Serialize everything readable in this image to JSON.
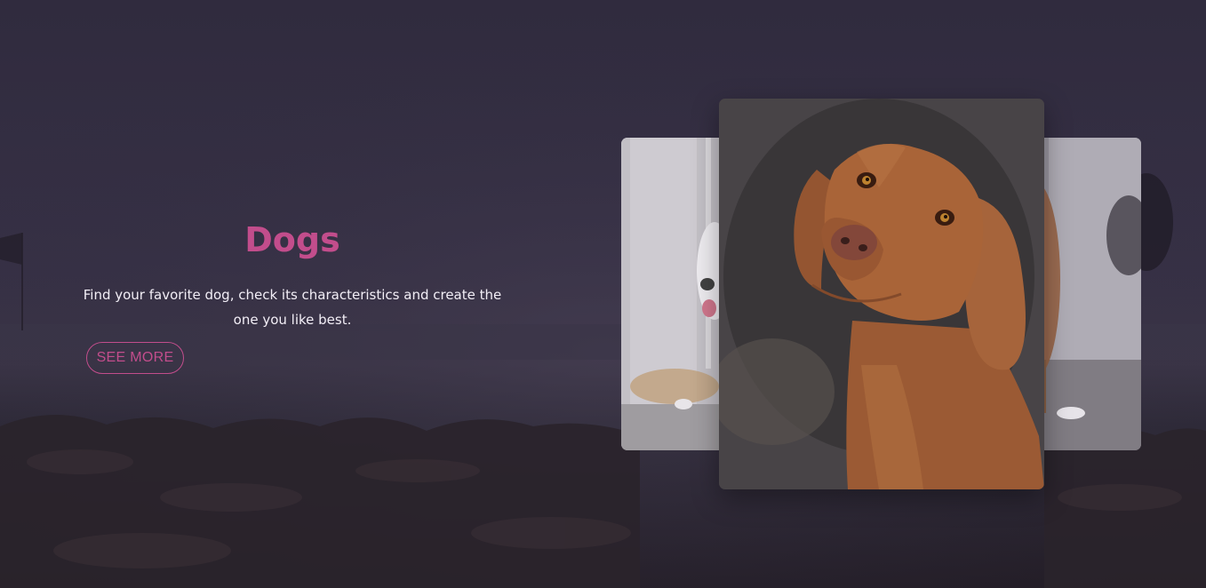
{
  "hero": {
    "title": "Dogs",
    "description": "Find your favorite dog, check its characteristics and create the one you like best.",
    "cta_label": "SEE MORE"
  },
  "carousel": {
    "slides": [
      {
        "position": "left",
        "subject": "white-dog-by-window"
      },
      {
        "position": "center",
        "subject": "brown-vizsla-dog",
        "active": true
      },
      {
        "position": "right",
        "subject": "brown-white-dog"
      }
    ]
  },
  "colors": {
    "accent": "#c24d8c",
    "overlay": "#2f2b3d"
  }
}
